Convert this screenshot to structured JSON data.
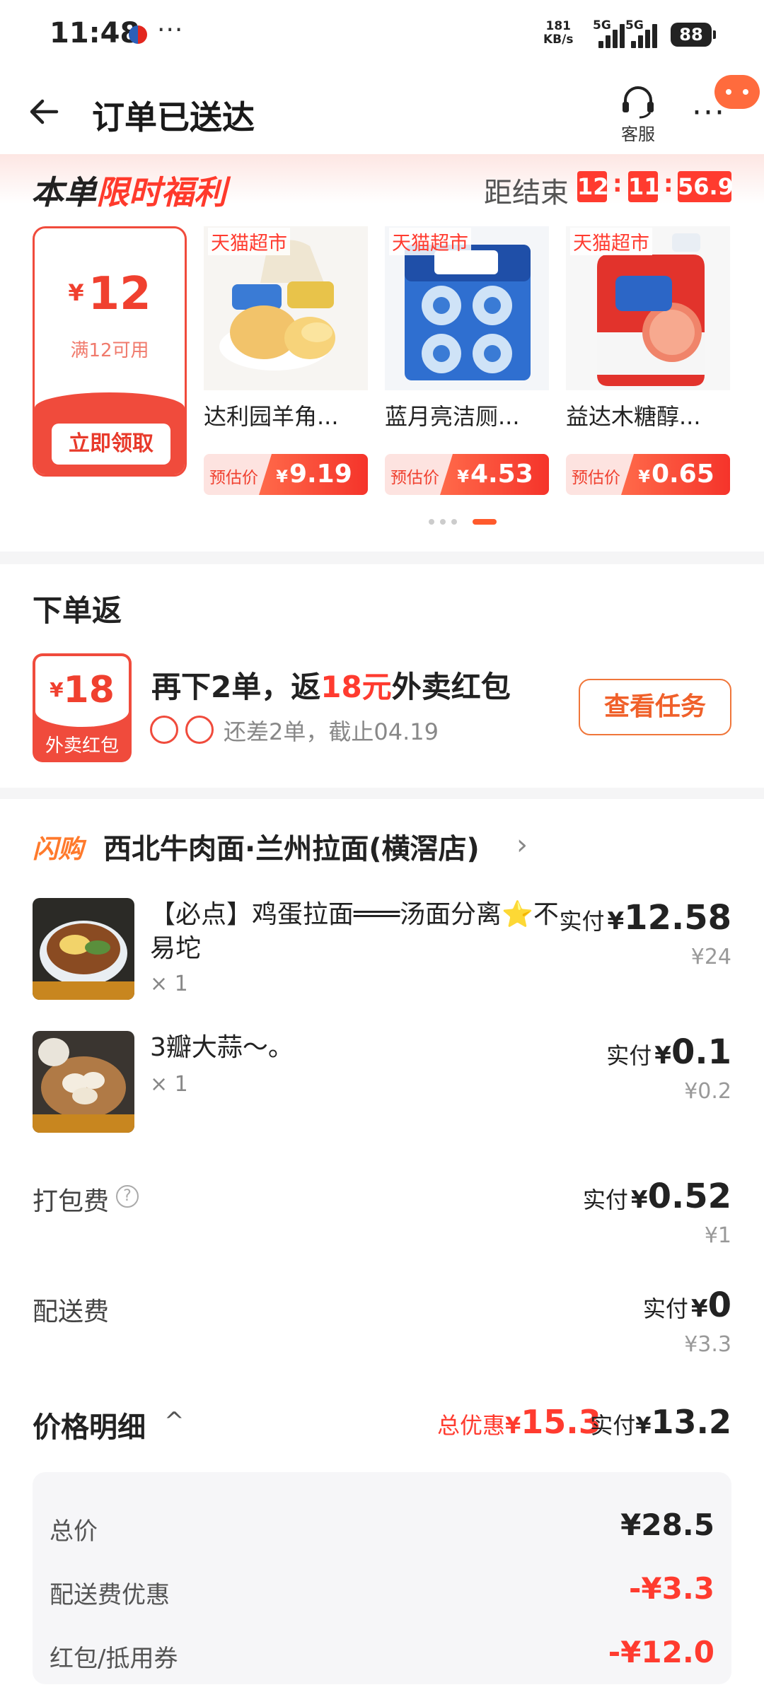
{
  "status_bar": {
    "time": "11:48",
    "more": "···",
    "net_speed_value": "181",
    "net_speed_unit": "KB/s",
    "signal1_label": "5G",
    "signal2_label": "5G",
    "battery": "88"
  },
  "header": {
    "title": "订单已送达",
    "service_label": "客服",
    "more": "···"
  },
  "welfare": {
    "title_prefix": "本单",
    "title_highlight": "限时福利",
    "countdown_label": "距结束",
    "countdown": {
      "hours": "12",
      "minutes": "11",
      "seconds": "56.9"
    },
    "separator": ":",
    "coupon": {
      "currency": "¥",
      "amount": "12",
      "condition": "满12可用",
      "button": "立即领取"
    },
    "products": [
      {
        "tag": "天猫超市",
        "name": "达利园羊角...",
        "est_label": "预估价",
        "currency": "¥",
        "price": "9.19"
      },
      {
        "tag": "天猫超市",
        "name": "蓝月亮洁厕...",
        "est_label": "预估价",
        "currency": "¥",
        "price": "4.53"
      },
      {
        "tag": "天猫超市",
        "name": "益达木糖醇...",
        "est_label": "预估价",
        "currency": "¥",
        "price": "0.65"
      }
    ],
    "pager": {
      "count": 4,
      "active": 3
    }
  },
  "rebate": {
    "title": "下单返",
    "packet_currency": "¥",
    "packet_amount": "18",
    "packet_label": "外卖红包",
    "main_prefix": "再下2单，返",
    "main_highlight": "18元",
    "main_suffix": "外卖红包",
    "sub": "还差2单，截止04.19",
    "button": "查看任务"
  },
  "order": {
    "flash_tag": "闪购",
    "shop_name": "西北牛肉面·兰州拉面(横滘店)",
    "chevron": "›",
    "items": [
      {
        "name": "【必点】鸡蛋拉面═══汤面分离⭐不易坨",
        "qty": "× 1",
        "paid_label": "实付",
        "currency": "¥",
        "paid": "12.58",
        "original": "¥24"
      },
      {
        "name": "3瓣大蒜～。",
        "qty": "× 1",
        "paid_label": "实付",
        "currency": "¥",
        "paid": "0.1",
        "original": "¥0.2"
      }
    ],
    "packing_fee": {
      "label": "打包费",
      "help": "?",
      "paid_label": "实付",
      "currency": "¥",
      "paid": "0.52",
      "original": "¥1"
    },
    "delivery_fee": {
      "label": "配送费",
      "paid_label": "实付",
      "currency": "¥",
      "paid": "0",
      "original": "¥3.3"
    },
    "price_detail": {
      "title": "价格明细",
      "chevron": "^",
      "discount_label": "总优惠",
      "discount_currency": "¥",
      "discount": "15.3",
      "paid_label": "实付",
      "paid_currency": "¥",
      "paid": "13.2",
      "rows": [
        {
          "label": "总价",
          "value": "¥28.5"
        },
        {
          "label": "配送费优惠",
          "value": "-¥3.3"
        },
        {
          "label": "红包/抵用券",
          "value": "-¥12.0"
        }
      ]
    }
  },
  "colors": {
    "accent_red": "#ff3b2f",
    "accent_orange": "#ff7a2c",
    "text_primary": "#222222",
    "text_muted": "#888888"
  }
}
